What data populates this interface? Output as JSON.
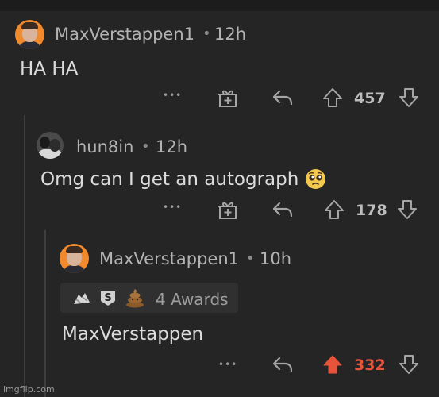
{
  "comments": [
    {
      "username": "MaxVerstappen1",
      "separator": "•",
      "time": "12h",
      "body": "HA HA",
      "actions": {
        "more": "•••",
        "vote_count": "457"
      }
    },
    {
      "username": "hun8in",
      "separator": "•",
      "time": "12h",
      "body": "Omg can I get an autograph",
      "actions": {
        "more": "•••",
        "vote_count": "178"
      }
    },
    {
      "username": "MaxVerstappen1",
      "separator": "•",
      "time": "10h",
      "awards_label": "4 Awards",
      "body": "MaxVerstappen",
      "actions": {
        "more": "•••",
        "vote_count": "332"
      }
    }
  ],
  "watermark": "imgflip.com",
  "colors": {
    "background": "#252525",
    "upvote_active": "#e8543a",
    "avatar_orange": "#f08a2c"
  },
  "icons": [
    "gift-icon",
    "reply-icon",
    "upvote-icon",
    "downvote-icon",
    "more-options-icon",
    "pleading-face-emoji",
    "award-hands-icon",
    "award-s-icon",
    "award-poop-icon"
  ]
}
